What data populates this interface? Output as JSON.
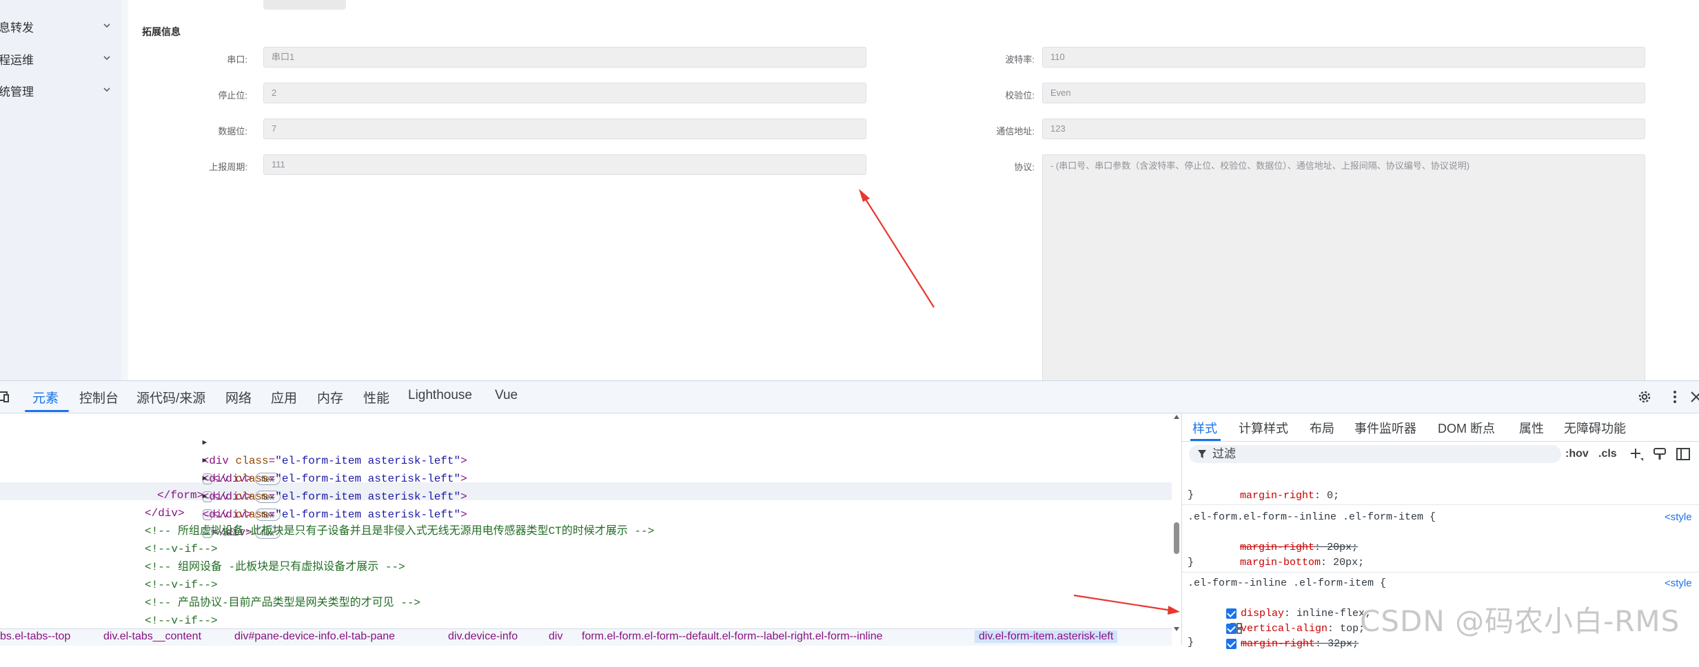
{
  "sidebar": {
    "items": [
      {
        "label": "息转发"
      },
      {
        "label": "程运维"
      },
      {
        "label": "统管理"
      }
    ]
  },
  "form": {
    "section_title": "拓展信息",
    "fields": {
      "serial_port": {
        "label": "串口:",
        "value": "串口1"
      },
      "baud_rate": {
        "label": "波特率:",
        "value": "110"
      },
      "stop_bit": {
        "label": "停止位:",
        "value": "2"
      },
      "parity": {
        "label": "校验位:",
        "value": "Even"
      },
      "data_bit": {
        "label": "数据位:",
        "value": "7"
      },
      "comm_address": {
        "label": "通信地址:",
        "value": "123"
      },
      "report_period": {
        "label": "上报周期:",
        "value": "111"
      },
      "protocol": {
        "label": "协议:",
        "value": "- (串口号、串口参数（含波特率、停止位、校验位、数据位）、通信地址、上报间隔、协议编号、协议说明)"
      }
    }
  },
  "devtools": {
    "tabs": [
      "元素",
      "控制台",
      "源代码/来源",
      "网络",
      "应用",
      "内存",
      "性能",
      "Lighthouse",
      "Vue"
    ],
    "active_tab": "元素",
    "elements": {
      "lines": [
        {
          "open": "<div ",
          "attr": "class",
          "val": "\"el-form-item asterisk-left\"",
          "close": "</div>",
          "badge": "flex"
        },
        {
          "open": "<div ",
          "attr": "class",
          "val": "\"el-form-item asterisk-left\"",
          "close": "</div>",
          "badge": "flex"
        },
        {
          "open": "<div ",
          "attr": "class",
          "val": "\"el-form-item asterisk-left\"",
          "close": "</div>",
          "badge": "flex",
          "suffix": "== $0"
        },
        {
          "open": "<div ",
          "attr": "class",
          "val": "\"el-form-item asterisk-left\"",
          "close": "</div>",
          "badge": "flex"
        }
      ],
      "form_close": "</form>",
      "div_close": "</div>",
      "comment1": "<!-- 所组虚拟设备-此板块是只有子设备并且是非侵入式无线无源用电传感器类型CT的时候才展示 -->",
      "vif1": "<!--v-if-->",
      "comment2": "<!-- 组网设备 -此板块是只有虚拟设备才展示 -->",
      "vif2": "<!--v-if-->",
      "comment3": "<!-- 产品协议-目前产品类型是网关类型的才可见 -->",
      "vif3": "<!--v-if-->",
      "dots": "…"
    },
    "breadcrumb": [
      "bs.el-tabs--top",
      "div.el-tabs__content",
      "div#pane-device-info.el-tab-pane",
      "div.device-info",
      "div",
      "form.el-form.el-form--default.el-form--label-right.el-form--inline",
      "div.el-form-item.asterisk-left"
    ],
    "styles": {
      "tabs": [
        "样式",
        "计算样式",
        "布局",
        "事件监听器",
        "DOM 断点",
        "属性",
        "无障碍功能"
      ],
      "filter_placeholder": "过滤",
      "hov": ":hov",
      "cls": ".cls",
      "rules": [
        {
          "prop": "margin-right",
          "value": "0;"
        },
        {
          "selector": ".el-form.el-form--inline .el-form-item {",
          "source": "<style",
          "decls": [
            {
              "prop": "margin-right",
              "value": "20px;",
              "struck": true
            },
            {
              "prop": "margin-bottom",
              "value": "20px;"
            }
          ]
        },
        {
          "selector": ".el-form--inline .el-form-item {",
          "source": "<style",
          "decls": [
            {
              "prop": "display",
              "value": "inline-flex;"
            },
            {
              "prop": "vertical-align",
              "value": "top;"
            },
            {
              "prop": "margin-right",
              "value": "32px;",
              "struck": true
            }
          ]
        }
      ],
      "closing_brace": "}"
    }
  },
  "watermark": "CSDN @码农小白-RMS",
  "colors": {
    "accent": "#1a73e8",
    "annotation_arrow": "#e8372e"
  }
}
